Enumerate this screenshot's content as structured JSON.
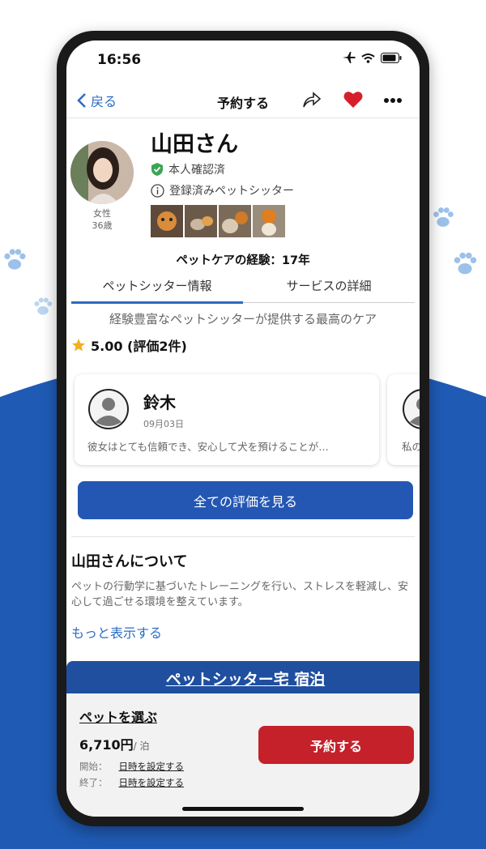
{
  "colors": {
    "brand_blue": "#1f4f9e",
    "accent_blue": "#2b6cc4",
    "button_blue": "#2457b3",
    "book_red": "#c4212a",
    "heart_red": "#d61f2b",
    "background_blue": "#1f5bb5"
  },
  "status_bar": {
    "time": "16:56"
  },
  "nav": {
    "back_label": "戻る",
    "title": "予約する"
  },
  "profile": {
    "name": "山田さん",
    "badges": [
      "本人確認済",
      "登録済みペットシッター"
    ],
    "gender": "女性",
    "age": "36歳",
    "experience": "ペットケアの経験：17年"
  },
  "tabs": [
    "ペットシッター情報",
    "サービスの詳細"
  ],
  "tagline": "経験豊富なペットシッターが提供する最高のケア",
  "rating": {
    "text": "5.00 (評価2件)"
  },
  "reviews": [
    {
      "name": "鈴木",
      "date": "09月03日",
      "text": "彼女はとても信頼でき、安心して犬を預けることが…"
    },
    {
      "text": "私の"
    }
  ],
  "all_reviews_label": "全ての評価を見る",
  "about": {
    "title": "山田さんについて",
    "text": "ペットの行動学に基づいたトレーニングを行い、ストレスを軽減し、安心して過ごせる環境を整えています。",
    "more_label": "もっと表示する"
  },
  "service": {
    "name": "ペットシッター宅 宿泊"
  },
  "booking": {
    "select_pet_label": "ペットを選ぶ",
    "price": "6,710円",
    "price_unit": "/ 泊",
    "start_label": "開始：",
    "end_label": "終了：",
    "set_datetime_label": "日時を設定する",
    "book_label": "予約する"
  }
}
